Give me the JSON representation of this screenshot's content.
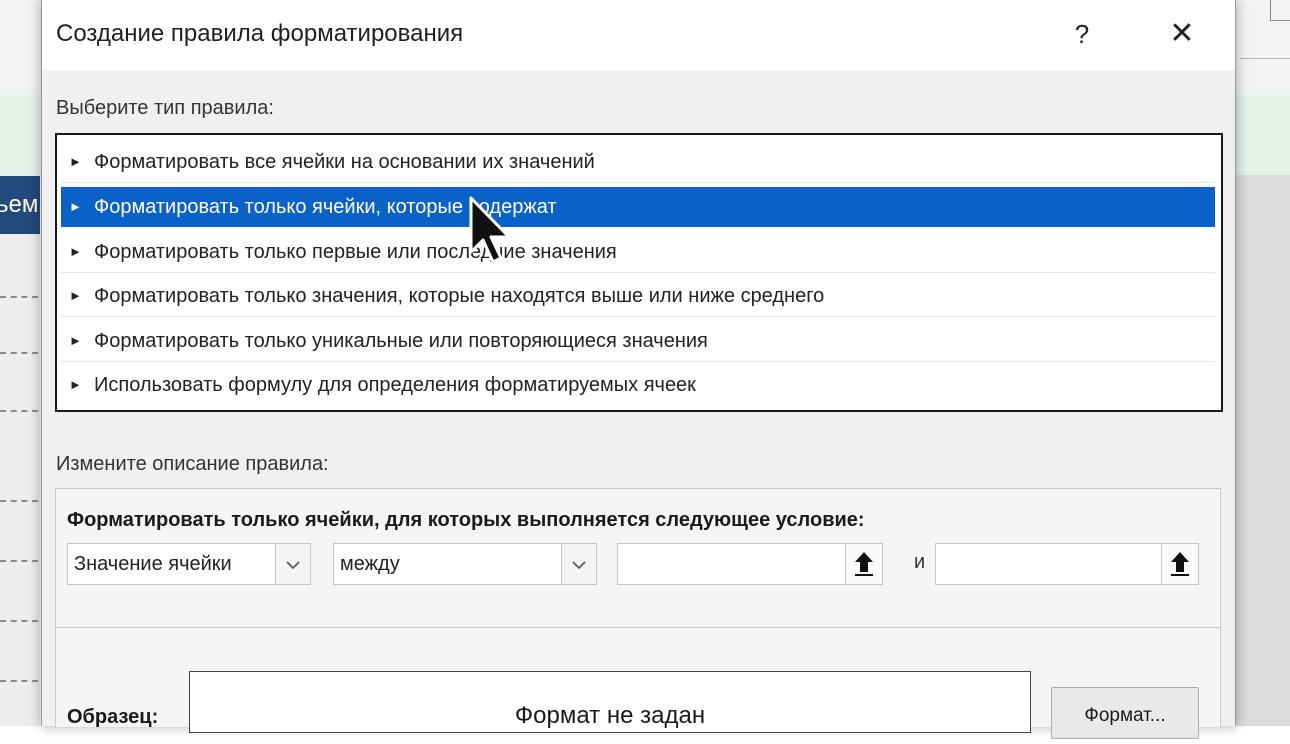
{
  "dialog": {
    "title": "Создание правила форматирования",
    "help_symbol": "?",
    "close_symbol": "✕"
  },
  "background": {
    "left_cell_text": "ьем"
  },
  "rule_type": {
    "label": "Выберите тип правила:",
    "items": [
      {
        "label": "Форматировать все ячейки на основании их значений",
        "selected": false
      },
      {
        "label": "Форматировать только ячейки, которые содержат",
        "selected": true
      },
      {
        "label": "Форматировать только первые или последние значения",
        "selected": false
      },
      {
        "label": "Форматировать только значения, которые находятся выше или ниже среднего",
        "selected": false
      },
      {
        "label": "Форматировать только уникальные или повторяющиеся значения",
        "selected": false
      },
      {
        "label": "Использовать формулу для определения форматируемых ячеек",
        "selected": false
      }
    ],
    "bullet_symbol": "►"
  },
  "rule_description": {
    "label": "Измените описание правила:",
    "condition_heading": "Форматировать только ячейки, для которых выполняется следующее условие:",
    "field_select": {
      "value": "Значение ячейки"
    },
    "operator_select": {
      "value": "между"
    },
    "value1": "",
    "and_label": "и",
    "value2": "",
    "preview_label": "Образец:",
    "preview_text": "Формат не задан",
    "format_button_label": "Формат..."
  },
  "icons": {
    "cursor": "mouse-pointer-icon",
    "dropdown": "chevron-down-icon",
    "reference": "range-select-arrow-icon"
  },
  "colors": {
    "selection": "#0a62c8",
    "dialog_bg": "#f0f0f0",
    "excel_header": "#234a7c"
  }
}
